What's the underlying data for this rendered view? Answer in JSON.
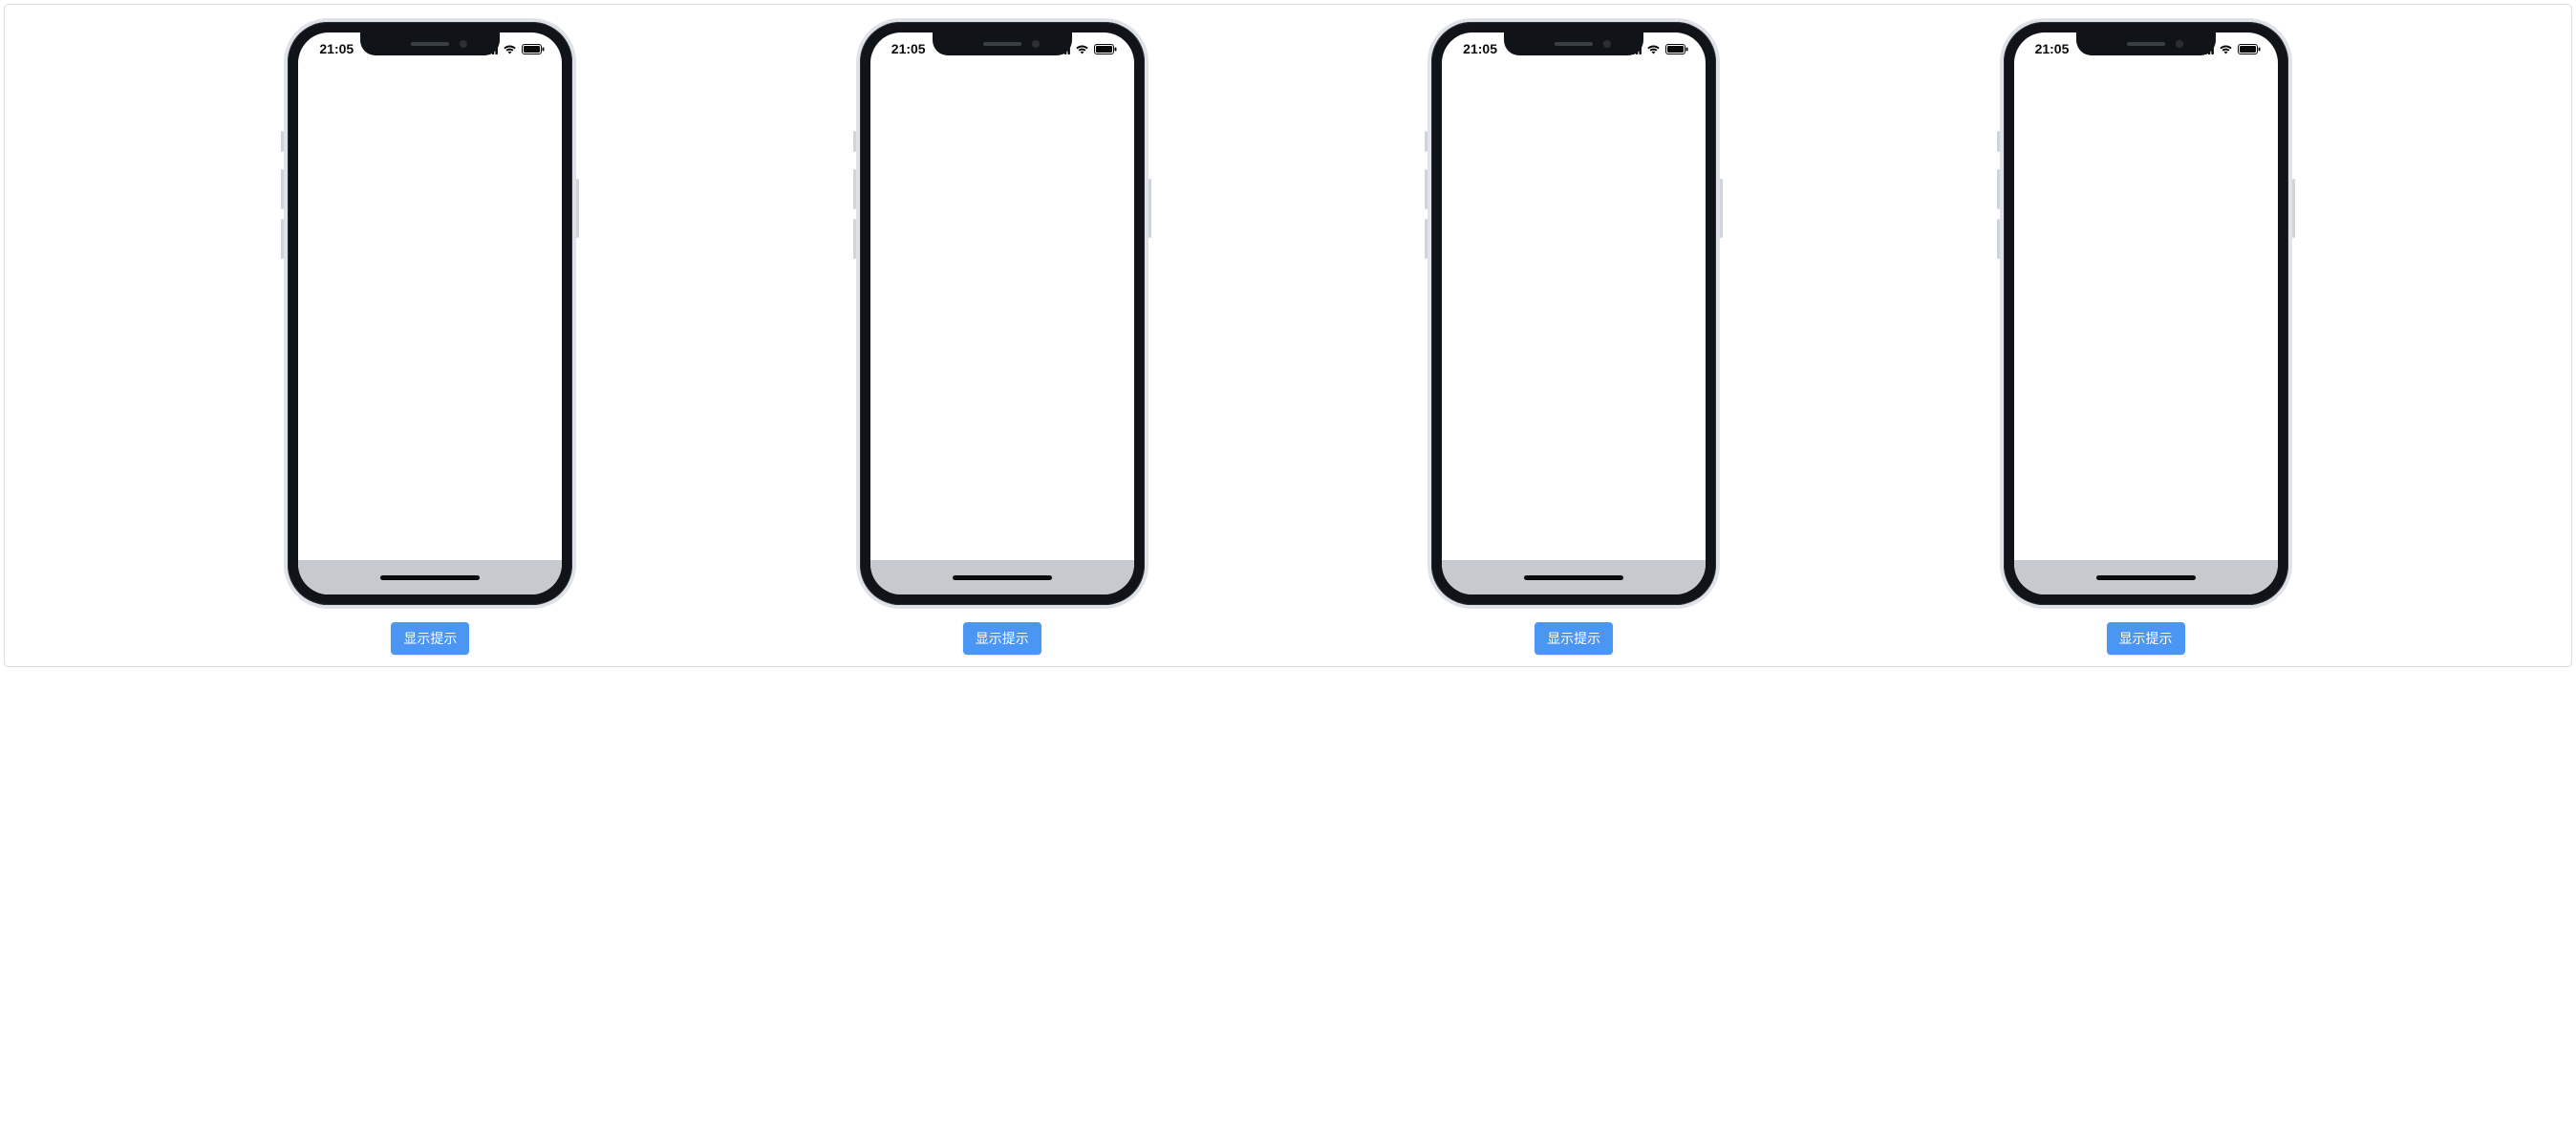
{
  "devices": [
    {
      "time": "21:05",
      "button_label": "显示提示"
    },
    {
      "time": "21:05",
      "button_label": "显示提示"
    },
    {
      "time": "21:05",
      "button_label": "显示提示"
    },
    {
      "time": "21:05",
      "button_label": "显示提示"
    }
  ],
  "icons": {
    "signal": "signal-icon",
    "wifi": "wifi-icon",
    "battery": "battery-icon"
  }
}
